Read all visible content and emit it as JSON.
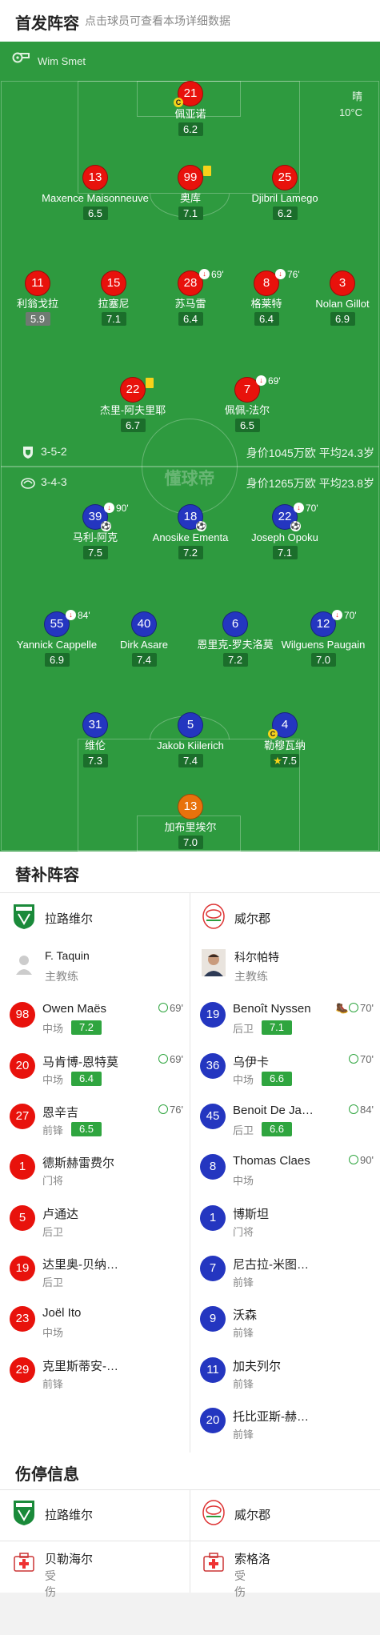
{
  "header": {
    "title": "首发阵容",
    "subtitle": "点击球员可查看本场详细数据"
  },
  "pitch": {
    "referee": "Wim Smet",
    "weather": "晴",
    "temperature": "10°C",
    "watermark": "懂球帝",
    "home_formation": "3-5-2",
    "home_value": "身价1045万欧 平均24.3岁",
    "away_formation": "3-4-3",
    "away_value": "身价1265万欧 平均23.8岁"
  },
  "home_players": [
    {
      "num": "21",
      "name": "佩亚诺",
      "rating": "6.2",
      "captain": true
    },
    {
      "num": "13",
      "name": "Maxence Maisonneuve",
      "rating": "6.5"
    },
    {
      "num": "99",
      "name": "奥库",
      "rating": "7.1",
      "yellow": true
    },
    {
      "num": "25",
      "name": "Djibril Lamego",
      "rating": "6.2"
    },
    {
      "num": "11",
      "name": "利翁戈拉",
      "rating": "5.9",
      "low": true
    },
    {
      "num": "15",
      "name": "拉塞尼",
      "rating": "7.1"
    },
    {
      "num": "28",
      "name": "苏马雷",
      "rating": "6.4",
      "sub": "69'"
    },
    {
      "num": "8",
      "name": "格莱特",
      "rating": "6.4",
      "sub": "76'"
    },
    {
      "num": "3",
      "name": "Nolan Gillot",
      "rating": "6.9"
    },
    {
      "num": "22",
      "name": "杰里-阿夫里耶",
      "rating": "6.7",
      "yellow": true
    },
    {
      "num": "7",
      "name": "佩佩-法尔",
      "rating": "6.5",
      "sub": "69'"
    }
  ],
  "away_players": [
    {
      "num": "39",
      "name": "马利-阿克",
      "rating": "7.5",
      "sub": "90'",
      "goal": true
    },
    {
      "num": "18",
      "name": "Anosike Ementa",
      "rating": "7.2",
      "goal": true
    },
    {
      "num": "22",
      "name": "Joseph Opoku",
      "rating": "7.1",
      "sub": "70'",
      "goal": true
    },
    {
      "num": "55",
      "name": "Yannick Cappelle",
      "rating": "6.9",
      "sub": "84'"
    },
    {
      "num": "40",
      "name": "Dirk Asare",
      "rating": "7.4"
    },
    {
      "num": "6",
      "name": "恩里克-罗夫洛莫",
      "rating": "7.2"
    },
    {
      "num": "12",
      "name": "Wilguens Paugain",
      "rating": "7.0",
      "sub": "70'"
    },
    {
      "num": "31",
      "name": "维伦",
      "rating": "7.3"
    },
    {
      "num": "5",
      "name": "Jakob Kiilerich",
      "rating": "7.4"
    },
    {
      "num": "4",
      "name": "勒穆瓦纳",
      "rating": "7.5",
      "captain": true,
      "star": true
    },
    {
      "num": "13",
      "name": "加布里埃尔",
      "rating": "7.0"
    }
  ],
  "subs": {
    "title": "替补阵容",
    "home_team": "拉路维尔",
    "away_team": "威尔郡",
    "home_coach": "F. Taquin",
    "away_coach": "科尔帕特",
    "coach_role": "主教练",
    "home": [
      {
        "num": "98",
        "name": "Owen Maës",
        "pos": "中场",
        "rating": "7.2",
        "in": "69'"
      },
      {
        "num": "20",
        "name": "马肯博-恩特莫",
        "pos": "中场",
        "rating": "6.4",
        "in": "69'"
      },
      {
        "num": "27",
        "name": "恩辛吉",
        "pos": "前锋",
        "rating": "6.5",
        "in": "76'"
      },
      {
        "num": "1",
        "name": "德斯赫雷费尔",
        "pos": "门将"
      },
      {
        "num": "5",
        "name": "卢通达",
        "pos": "后卫"
      },
      {
        "num": "19",
        "name": "达里奥-贝纳…",
        "pos": "后卫"
      },
      {
        "num": "23",
        "name": "Joël Ito",
        "pos": "中场"
      },
      {
        "num": "29",
        "name": "克里斯蒂安-…",
        "pos": "前锋"
      }
    ],
    "away": [
      {
        "num": "19",
        "name": "Benoît Nyssen",
        "pos": "后卫",
        "rating": "7.1",
        "in": "70'",
        "assist": true
      },
      {
        "num": "36",
        "name": "乌伊卡",
        "pos": "中场",
        "rating": "6.6",
        "in": "70'"
      },
      {
        "num": "45",
        "name": "Benoit De Ja…",
        "pos": "后卫",
        "rating": "6.6",
        "in": "84'"
      },
      {
        "num": "8",
        "name": "Thomas Claes",
        "pos": "中场",
        "in": "90'"
      },
      {
        "num": "1",
        "name": "博斯坦",
        "pos": "门将"
      },
      {
        "num": "7",
        "name": "尼古拉-米图…",
        "pos": "前锋"
      },
      {
        "num": "9",
        "name": "沃森",
        "pos": "前锋"
      },
      {
        "num": "11",
        "name": "加夫列尔",
        "pos": "前锋"
      },
      {
        "num": "20",
        "name": "托比亚斯-赫…",
        "pos": "前锋"
      }
    ]
  },
  "injuries": {
    "title": "伤停信息",
    "home_team": "拉路维尔",
    "away_team": "威尔郡",
    "home": [
      {
        "name": "贝勒海尔",
        "status": "受伤"
      }
    ],
    "away": [
      {
        "name": "索格洛",
        "status": "受伤"
      }
    ]
  },
  "colors": {
    "pitch": "#2e9a3f",
    "home": "#e8120c",
    "away": "#2436c0",
    "rating": "#2fa53f"
  }
}
